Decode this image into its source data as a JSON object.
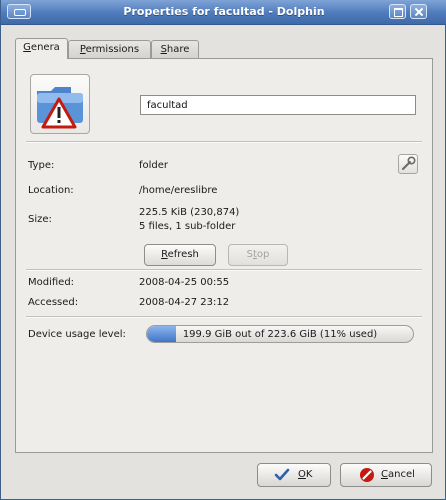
{
  "window": {
    "title": "Properties for facultad - Dolphin"
  },
  "tabs": [
    {
      "pre": "",
      "u": "G",
      "post": "enera"
    },
    {
      "pre": "",
      "u": "P",
      "post": "ermissions"
    },
    {
      "pre": "",
      "u": "S",
      "post": "hare"
    }
  ],
  "general": {
    "name_value": "facultad",
    "type_label": "Type:",
    "type_value": "folder",
    "location_label": "Location:",
    "location_value": "/home/ereslibre",
    "size_label": "Size:",
    "size_value": "225.5 KiB (230,874)",
    "size_detail": "5 files, 1 sub-folder",
    "refresh": {
      "u": "R",
      "post": "efresh"
    },
    "stop": {
      "pre": "S",
      "u": "t",
      "post": "op"
    },
    "modified_label": "Modified:",
    "modified_value": "2008-04-25 00:55",
    "accessed_label": "Accessed:",
    "accessed_value": "2008-04-27 23:12",
    "usage_label": "Device usage level:",
    "usage_text": "199.9 GiB out of 223.6 GiB (11% used)",
    "usage_fraction": 0.11
  },
  "footer": {
    "ok": {
      "u": "O",
      "post": "K"
    },
    "cancel": {
      "u": "C",
      "post": "ancel"
    }
  },
  "colors": {
    "titlebar": "#4f7bbb",
    "folder": "#5b93d8",
    "warning": "#c41a12",
    "usage_fill": "#3d76c9"
  },
  "icons": {
    "folder": "folder-icon",
    "warning": "warning-icon",
    "settings": "gear-icon",
    "ok": "checkmark-icon",
    "cancel": "cancel-icon"
  }
}
